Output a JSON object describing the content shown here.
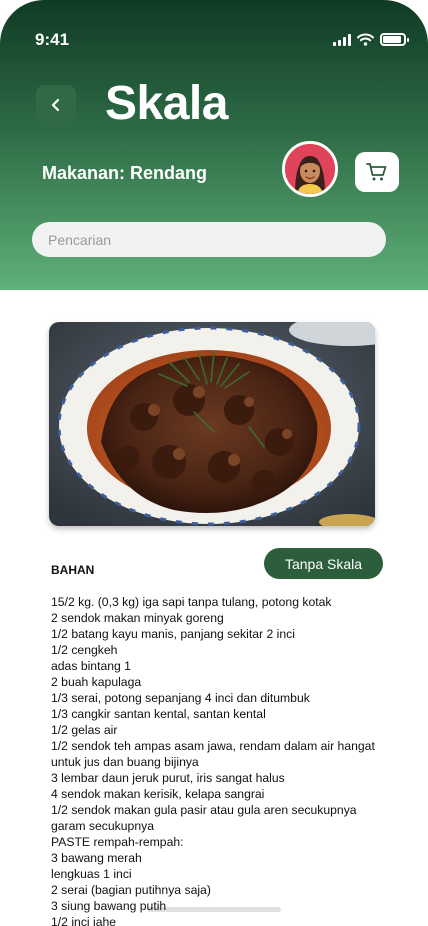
{
  "status_bar": {
    "time": "9:41"
  },
  "header": {
    "title": "Skala",
    "dish_label": "Makanan: Rendang"
  },
  "search": {
    "placeholder": "Pencarian"
  },
  "recipe": {
    "section_heading": "BAHAN",
    "scale_button_label": "Tanpa Skala",
    "ingredients": [
      "15/2 kg. (0,3 kg) iga sapi tanpa tulang, potong kotak",
      "2 sendok makan minyak goreng",
      "1/2 batang kayu manis, panjang sekitar 2 inci",
      "1/2 cengkeh",
      "adas bintang 1",
      "2 buah kapulaga",
      "1/3 serai, potong sepanjang 4 inci dan ditumbuk",
      "1/3 cangkir santan kental, santan kental",
      "1/2 gelas air",
      "1/2 sendok teh ampas asam jawa, rendam dalam air hangat",
      "untuk jus dan buang bijinya",
      "3 lembar daun jeruk purut, iris sangat halus",
      "4 sendok makan kerisik, kelapa sangrai",
      "1/2 sendok makan gula pasir atau gula aren secukupnya",
      "garam secukupnya",
      "PASTE rempah-rempah:",
      "3 bawang merah",
      "lengkuas 1 inci",
      "2 serai (bagian putihnya saja)",
      "3 siung bawang putih",
      "1/2 inci jahe"
    ]
  },
  "icons": {
    "back": "chevron-left-icon",
    "cart": "cart-icon",
    "avatar": "avatar"
  },
  "colors": {
    "header_top": "#0f3b25",
    "header_bottom": "#5fb07a",
    "accent": "#2d5e3c",
    "avatar_bg": "#e0435a"
  }
}
